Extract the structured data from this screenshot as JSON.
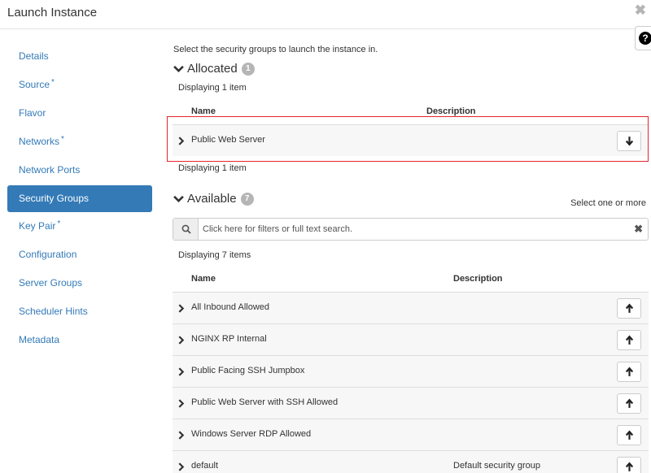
{
  "modal": {
    "title": "Launch Instance",
    "close_glyph": "✖",
    "help_glyph": "?"
  },
  "sidebar": {
    "items": [
      {
        "label": "Details",
        "required": false,
        "active": false
      },
      {
        "label": "Source",
        "required": true,
        "active": false
      },
      {
        "label": "Flavor",
        "required": false,
        "active": false
      },
      {
        "label": "Networks",
        "required": true,
        "active": false
      },
      {
        "label": "Network Ports",
        "required": false,
        "active": false
      },
      {
        "label": "Security Groups",
        "required": false,
        "active": true
      },
      {
        "label": "Key Pair",
        "required": true,
        "active": false
      },
      {
        "label": "Configuration",
        "required": false,
        "active": false
      },
      {
        "label": "Server Groups",
        "required": false,
        "active": false
      },
      {
        "label": "Scheduler Hints",
        "required": false,
        "active": false
      },
      {
        "label": "Metadata",
        "required": false,
        "active": false
      }
    ],
    "required_marker": "*"
  },
  "main": {
    "instruction": "Select the security groups to launch the instance in.",
    "allocated": {
      "title": "Allocated",
      "count": "1",
      "display_top": "Displaying 1 item",
      "display_bottom": "Displaying 1 item",
      "columns": {
        "name": "Name",
        "description": "Description"
      },
      "rows": [
        {
          "name": "Public Web Server",
          "description": ""
        }
      ]
    },
    "available": {
      "title": "Available",
      "count": "7",
      "select_hint": "Select one or more",
      "search_placeholder": "Click here for filters or full text search.",
      "search_clear": "✖",
      "display": "Displaying 7 items",
      "columns": {
        "name": "Name",
        "description": "Description"
      },
      "rows": [
        {
          "name": "All Inbound Allowed",
          "description": ""
        },
        {
          "name": "NGINX RP Internal",
          "description": ""
        },
        {
          "name": "Public Facing SSH Jumpbox",
          "description": ""
        },
        {
          "name": "Public Web Server with SSH Allowed",
          "description": ""
        },
        {
          "name": "Windows Server RDP Allowed",
          "description": ""
        },
        {
          "name": "default",
          "description": "Default security group"
        }
      ]
    }
  },
  "colors": {
    "accent": "#337ab7",
    "highlight": "#e3262b",
    "badge": "#b5b5b5"
  }
}
